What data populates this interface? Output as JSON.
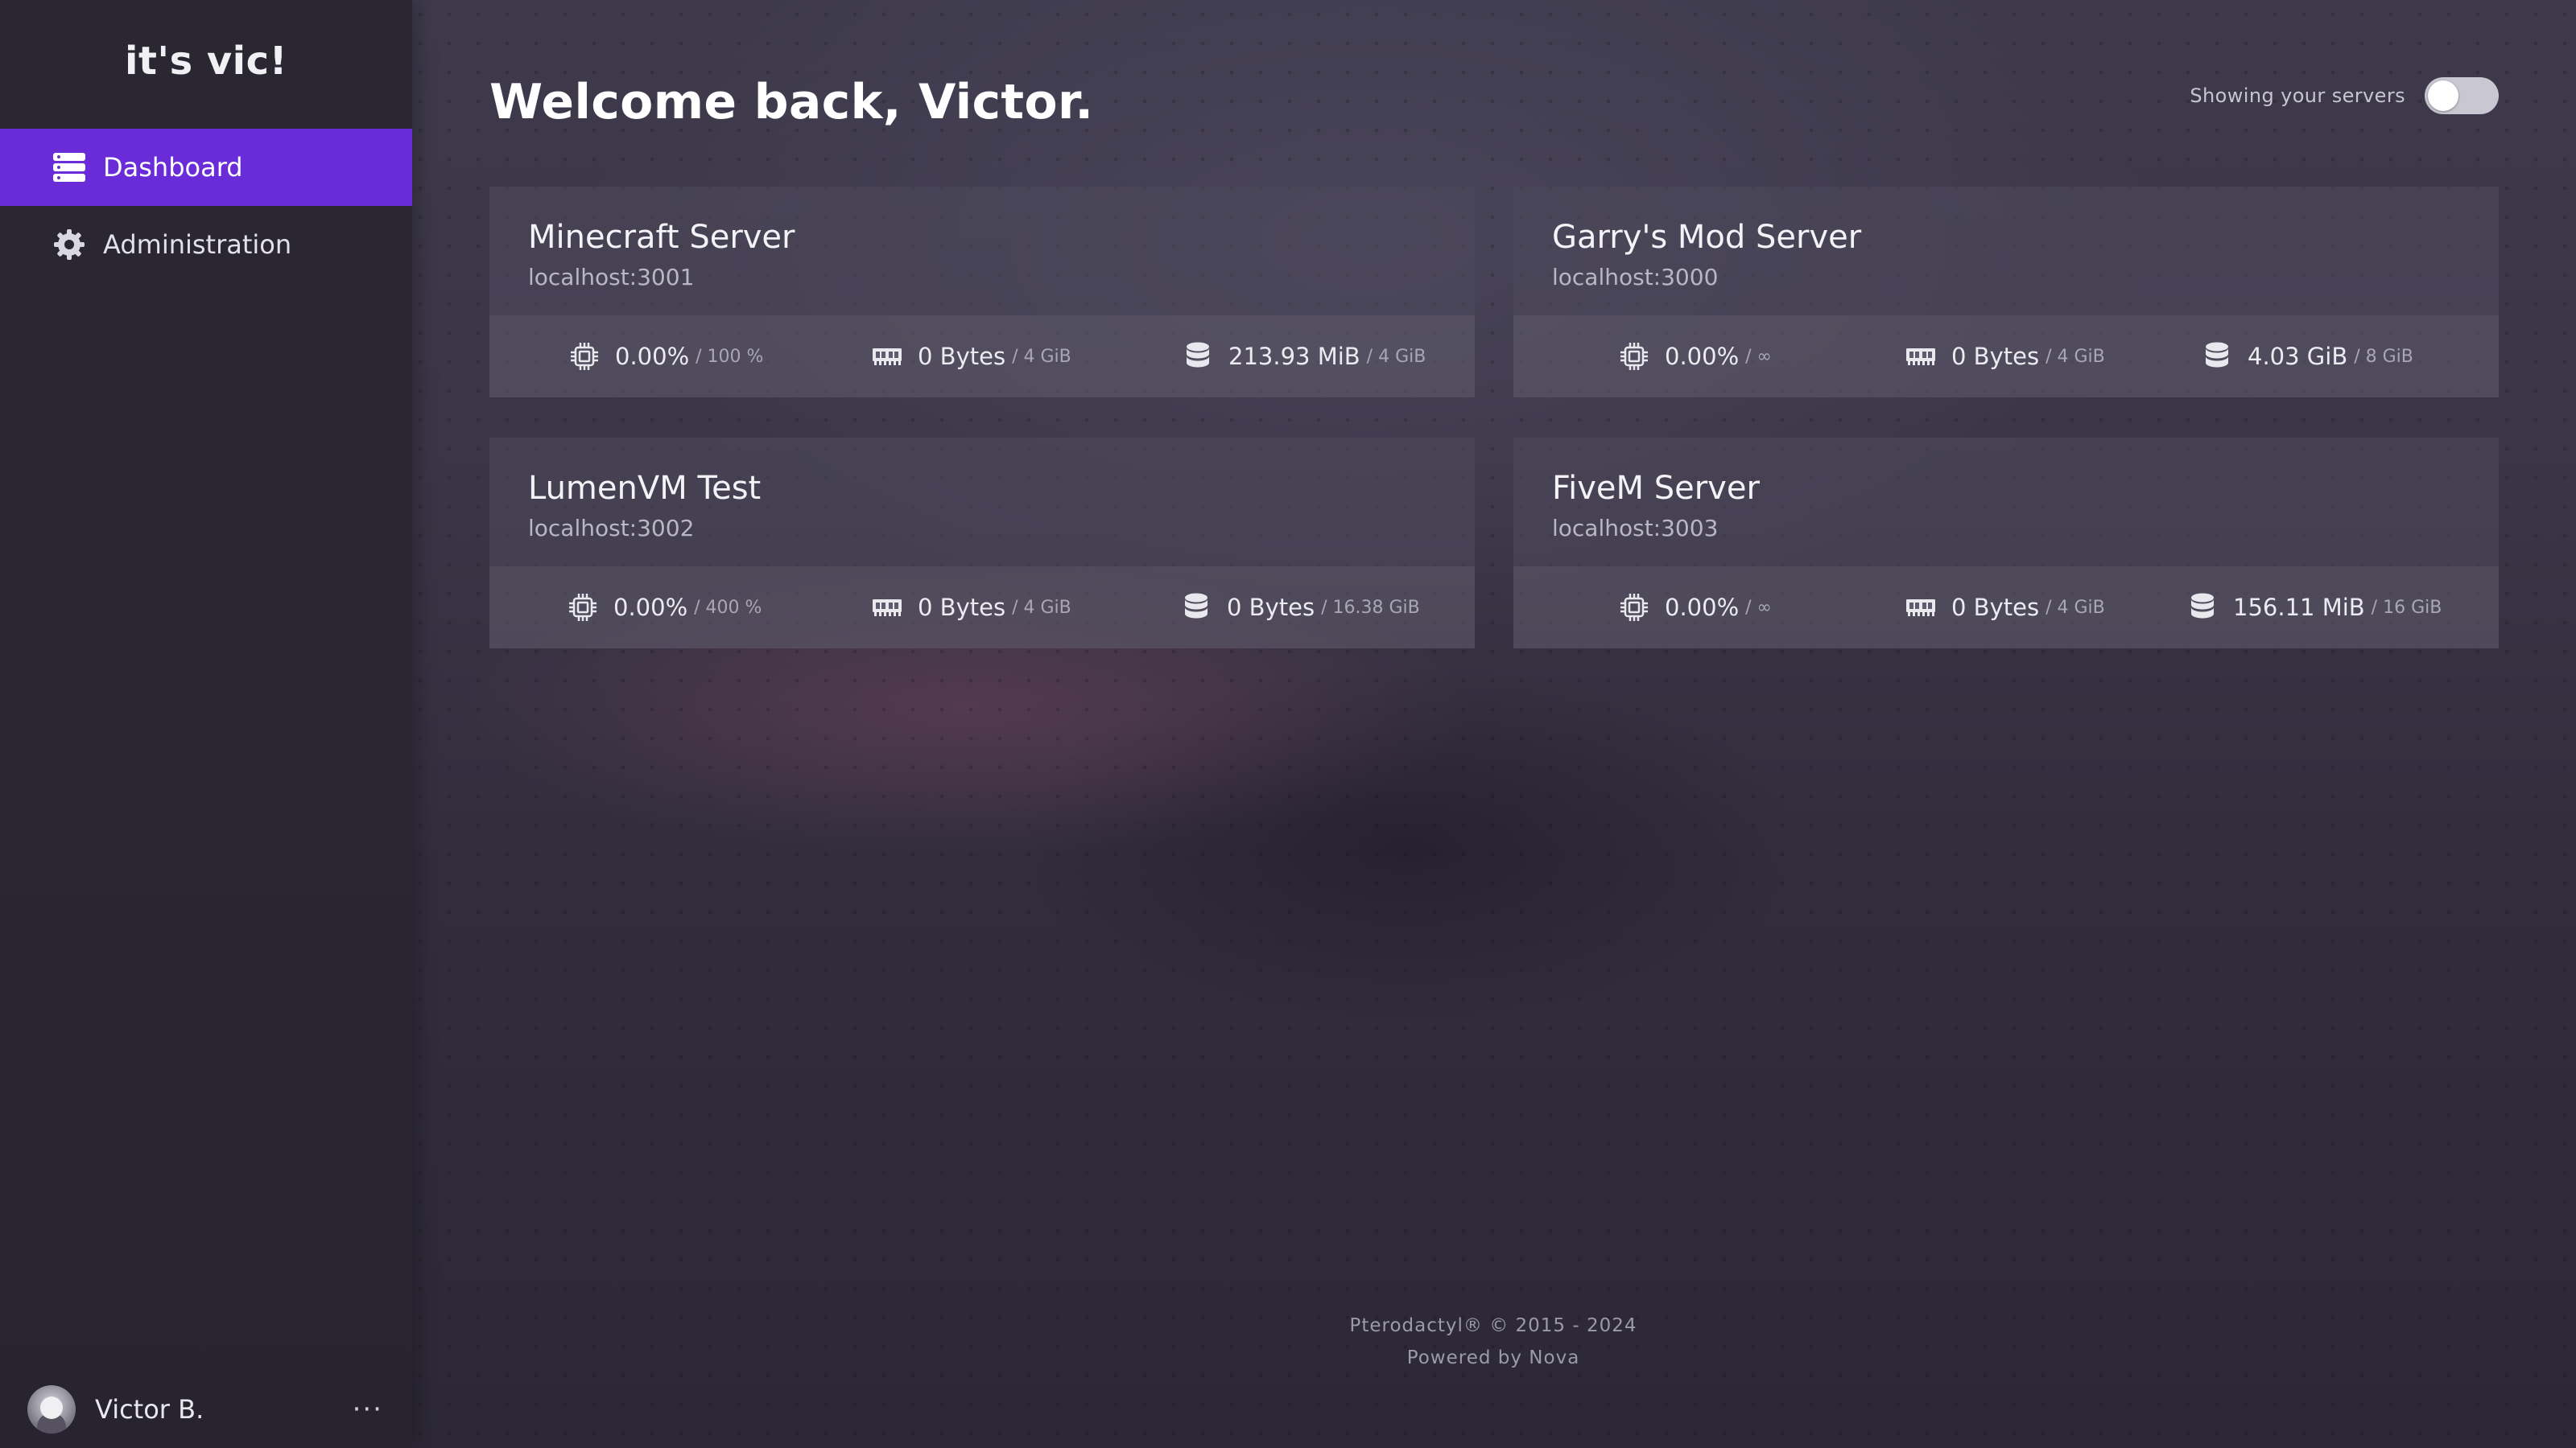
{
  "app": {
    "brand": "it's vic!"
  },
  "sidebar": {
    "items": [
      {
        "label": "Dashboard",
        "icon": "server-stack-icon",
        "active": true
      },
      {
        "label": "Administration",
        "icon": "gear-icon",
        "active": false
      }
    ],
    "user": {
      "name": "Victor B.",
      "menu_label": "···"
    }
  },
  "header": {
    "title": "Welcome back, Victor.",
    "toggle_label": "Showing your servers",
    "toggle_on": false
  },
  "servers": [
    {
      "name": "Minecraft Server",
      "address": "localhost:3001",
      "cpu": "0.00%",
      "cpu_limit": "/ 100 %",
      "memory": "0 Bytes",
      "memory_limit": "/ 4 GiB",
      "disk": "213.93 MiB",
      "disk_limit": "/ 4 GiB"
    },
    {
      "name": "Garry's Mod Server",
      "address": "localhost:3000",
      "cpu": "0.00%",
      "cpu_limit": "/ ∞",
      "memory": "0 Bytes",
      "memory_limit": "/ 4 GiB",
      "disk": "4.03 GiB",
      "disk_limit": "/ 8 GiB"
    },
    {
      "name": "LumenVM Test",
      "address": "localhost:3002",
      "cpu": "0.00%",
      "cpu_limit": "/ 400 %",
      "memory": "0 Bytes",
      "memory_limit": "/ 4 GiB",
      "disk": "0 Bytes",
      "disk_limit": "/ 16.38 GiB"
    },
    {
      "name": "FiveM Server",
      "address": "localhost:3003",
      "cpu": "0.00%",
      "cpu_limit": "/ ∞",
      "memory": "0 Bytes",
      "memory_limit": "/ 4 GiB",
      "disk": "156.11 MiB",
      "disk_limit": "/ 16 GiB"
    }
  ],
  "footer": {
    "copyright": "Pterodactyl® © 2015 - 2024",
    "powered_by": "Powered by Nova"
  },
  "colors": {
    "accent": "#6a2bd9",
    "sidebar_bg": "#2a2733"
  }
}
